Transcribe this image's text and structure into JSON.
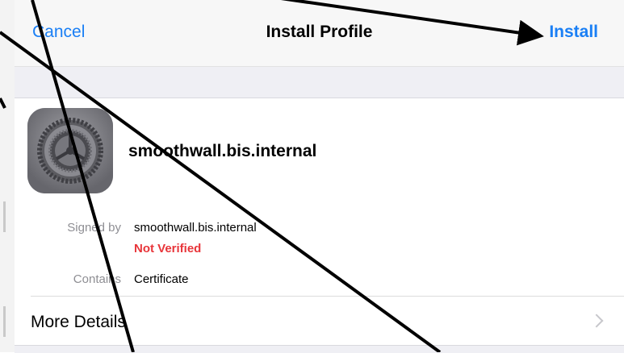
{
  "navbar": {
    "cancel_label": "Cancel",
    "title": "Install Profile",
    "install_label": "Install"
  },
  "profile": {
    "name": "smoothwall.bis.internal",
    "icon": "settings-gear-icon"
  },
  "details": {
    "signed_by_label": "Signed by",
    "signed_by_value": "smoothwall.bis.internal",
    "verification_status": "Not Verified",
    "contains_label": "Contains",
    "contains_value": "Certificate"
  },
  "more_details": {
    "label": "More Details"
  },
  "colors": {
    "accent": "#1a7ff5",
    "warning": "#e8353a",
    "secondary_text": "#8e8e93",
    "annotation_arrow": "#000000"
  }
}
